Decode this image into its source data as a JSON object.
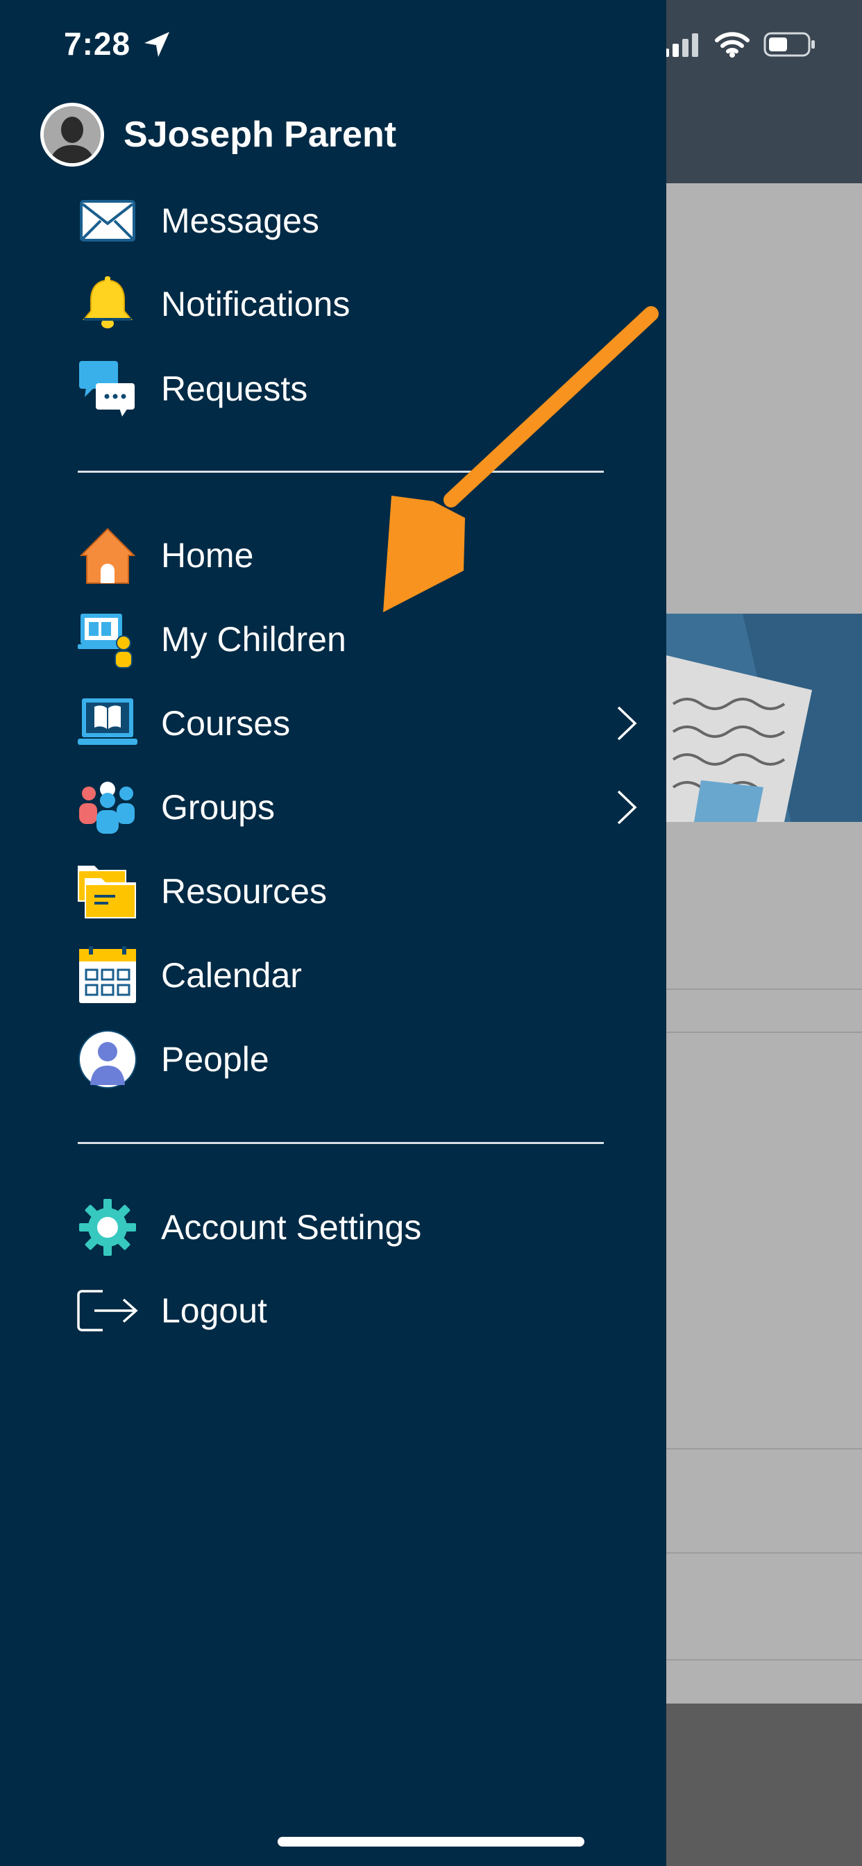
{
  "status_bar": {
    "time": "7:28"
  },
  "profile": {
    "name": "SJoseph Parent"
  },
  "menu": {
    "section1": [
      {
        "label": "Messages",
        "icon": "envelope-icon"
      },
      {
        "label": "Notifications",
        "icon": "bell-icon"
      },
      {
        "label": "Requests",
        "icon": "chat-bubbles-icon"
      }
    ],
    "section2": [
      {
        "label": "Home",
        "icon": "house-icon"
      },
      {
        "label": "My Children",
        "icon": "child-laptop-icon"
      },
      {
        "label": "Courses",
        "icon": "book-laptop-icon",
        "has_submenu": true
      },
      {
        "label": "Groups",
        "icon": "people-group-icon",
        "has_submenu": true
      },
      {
        "label": "Resources",
        "icon": "folders-icon"
      },
      {
        "label": "Calendar",
        "icon": "calendar-icon"
      },
      {
        "label": "People",
        "icon": "person-icon"
      }
    ],
    "section3": [
      {
        "label": "Account Settings",
        "icon": "gear-icon"
      },
      {
        "label": "Logout",
        "icon": "logout-icon"
      }
    ]
  },
  "colors": {
    "drawer_bg": "#002a45",
    "callout_arrow": "#f7931e",
    "backdrop": "#b2b2b2"
  }
}
